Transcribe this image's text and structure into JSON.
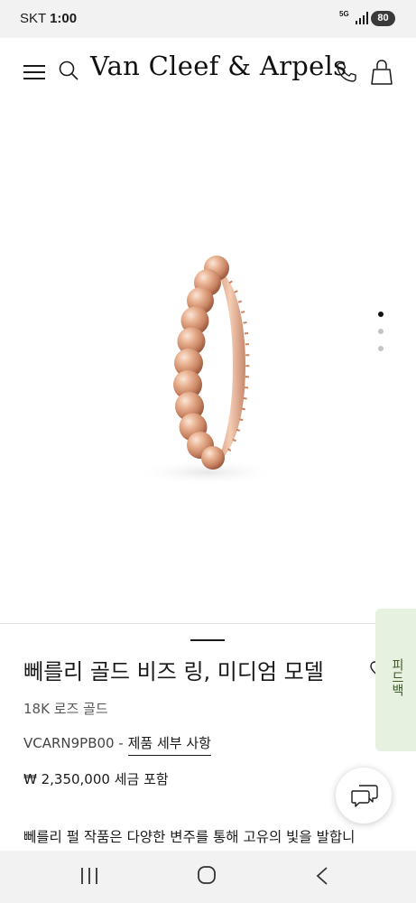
{
  "status_bar": {
    "carrier": "SKT",
    "time": "1:00",
    "network": "5G",
    "battery": "80"
  },
  "header": {
    "brand": "Van Cleef & Arpels",
    "icons": [
      "menu-icon",
      "search-icon",
      "phone-icon",
      "shopping-bag-icon"
    ]
  },
  "gallery": {
    "image": "rose-gold-beaded-ring",
    "page_count": 3,
    "active_page": 1
  },
  "product": {
    "title": "뻬를리 골드 비즈 링, 미디엄 모델",
    "material": "18K 로즈 골드",
    "sku": "VCARN9PB00",
    "sku_separator": "-",
    "details_link": "제품 세부 사항",
    "price": "₩ 2,350,000 세금 포함",
    "description": "뻬를리 펄 작품은 다양한 변주를 통해 고유의 빛을 발합니"
  },
  "feedback_tab": {
    "label": "피드백"
  },
  "colors": {
    "feedback_bg": "#e7f1df",
    "feedback_text": "#3d5a2e",
    "system_bar_bg": "#f2f2f2",
    "ring_rose_gold": "#e2a989"
  },
  "navigation": {
    "icons": [
      "recents-icon",
      "home-icon",
      "back-icon"
    ]
  }
}
